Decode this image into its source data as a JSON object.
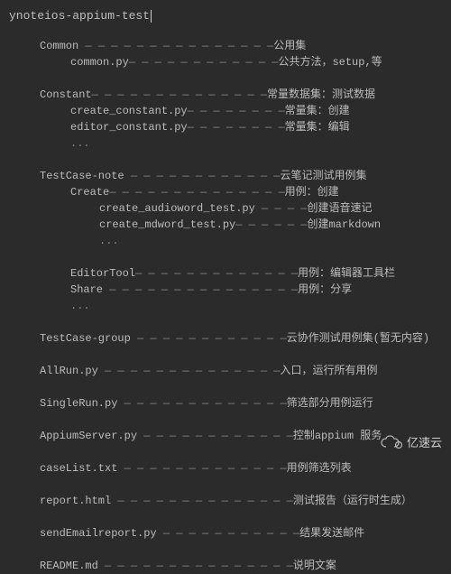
{
  "title": "ynoteios-appium-test",
  "watermark": "亿速云",
  "tree": [
    {
      "indent": "i1",
      "left": "Common",
      "fill": " — — — — — — — — — — — — — — —",
      "right": "公用集"
    },
    {
      "indent": "i2",
      "left": "common.py",
      "fill": "— — — — — — — — — — — —",
      "right": "公共方法，setup,等"
    },
    {
      "blank": true
    },
    {
      "indent": "i1",
      "left": "Constant",
      "fill": "— — — — — — — — — — — — — —",
      "right": "常量数据集：测试数据"
    },
    {
      "indent": "i2",
      "left": "create_constant.py",
      "fill": "— — — — — — — —",
      "right": "常量集：创建"
    },
    {
      "indent": "i2",
      "left": "editor_constant.py",
      "fill": "— — — — — — — —",
      "right": "常量集：编辑"
    },
    {
      "indent": "i2",
      "dots": true
    },
    {
      "blank": true
    },
    {
      "indent": "i1",
      "left": "TestCase-note",
      "fill": " — — — — — — — — — — — —",
      "right": "云笔记测试用例集"
    },
    {
      "indent": "i2",
      "left": "Create",
      "fill": "— — — — — — — — — — — — — —",
      "right": "用例：创建"
    },
    {
      "indent": "i3",
      "left": "create_audioword_test.py",
      "fill": " — — — —",
      "right": "创建语音速记"
    },
    {
      "indent": "i3",
      "left": "create_mdword_test.py",
      "fill": "— — — — — —",
      "right": "创建markdown"
    },
    {
      "indent": "i3",
      "dots": true
    },
    {
      "blank": true
    },
    {
      "indent": "i2",
      "left": "EditorTool",
      "fill": "— — — — — — — — — — — — —",
      "right": "用例：编辑器工具栏"
    },
    {
      "indent": "i2",
      "left": "Share",
      "fill": " — — — — — — — — — — — — — — —",
      "right": "用例：分享"
    },
    {
      "indent": "i2",
      "dots": true
    },
    {
      "blank": true
    },
    {
      "indent": "i1",
      "left": "TestCase-group",
      "fill": " — — — — — — — — — — — —",
      "right": "云协作测试用例集(暂无内容)"
    },
    {
      "blank": true
    },
    {
      "indent": "i1",
      "left": "AllRun.py",
      "fill": " — — — — — — — — — — — — — —",
      "right": "入口，运行所有用例"
    },
    {
      "blank": true
    },
    {
      "indent": "i1",
      "left": "SingleRun.py",
      "fill": " — — — — — — — — — — — — —",
      "right": "筛选部分用例运行"
    },
    {
      "blank": true
    },
    {
      "indent": "i1",
      "left": "AppiumServer.py",
      "fill": " — — — — — — — — — — — —",
      "right": "控制appium 服务"
    },
    {
      "blank": true
    },
    {
      "indent": "i1",
      "left": "caseList.txt",
      "fill": " — — — — — — — — — — — — —",
      "right": "用例筛选列表"
    },
    {
      "blank": true
    },
    {
      "indent": "i1",
      "left": "report.html",
      "fill": " — — — — — — — — — — — — — —",
      "right": "测试报告（运行时生成）"
    },
    {
      "blank": true
    },
    {
      "indent": "i1",
      "left": "sendEmailreport.py",
      "fill": " — — — — — — — — — — —",
      "right": "结果发送邮件"
    },
    {
      "blank": true
    },
    {
      "indent": "i1",
      "left": "README.md",
      "fill": " — — — — — — — — — — — — — — —",
      "right": "说明文案"
    }
  ]
}
